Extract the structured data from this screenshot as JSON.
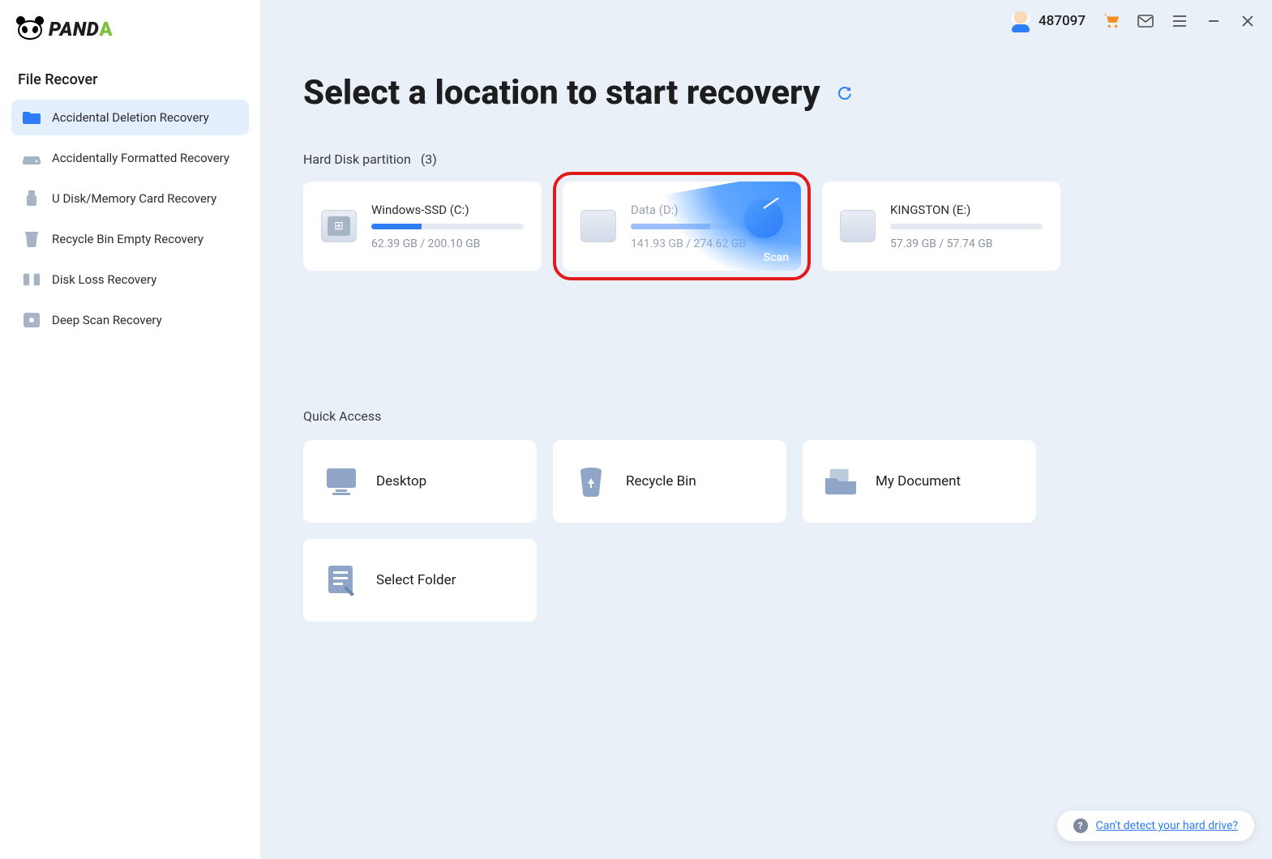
{
  "brand": "PANDA",
  "header": {
    "credits": "487097"
  },
  "sidebar": {
    "section": "File Recover",
    "items": [
      {
        "label": "Accidental Deletion Recovery"
      },
      {
        "label": "Accidentally Formatted Recovery"
      },
      {
        "label": "U Disk/Memory Card Recovery"
      },
      {
        "label": "Recycle Bin Empty Recovery"
      },
      {
        "label": "Disk Loss Recovery"
      },
      {
        "label": "Deep Scan Recovery"
      }
    ]
  },
  "main": {
    "title": "Select a location to start recovery",
    "partitions_label": "Hard Disk partition",
    "partitions_count": "(3)",
    "scan_label": "Scan",
    "disks": [
      {
        "name": "Windows-SSD   (C:)",
        "usage": "62.39 GB / 200.10 GB",
        "fill": 33
      },
      {
        "name": "Data   (D:)",
        "usage": "141.93 GB / 274.62 GB",
        "fill": 52
      },
      {
        "name": "KINGSTON   (E:)",
        "usage": "57.39 GB / 57.74 GB",
        "fill": 0
      }
    ],
    "quick_access_label": "Quick Access",
    "quick": [
      {
        "label": "Desktop"
      },
      {
        "label": "Recycle Bin"
      },
      {
        "label": "My Document"
      },
      {
        "label": "Select Folder"
      }
    ]
  },
  "help": {
    "text": "Can't detect your hard drive?"
  }
}
